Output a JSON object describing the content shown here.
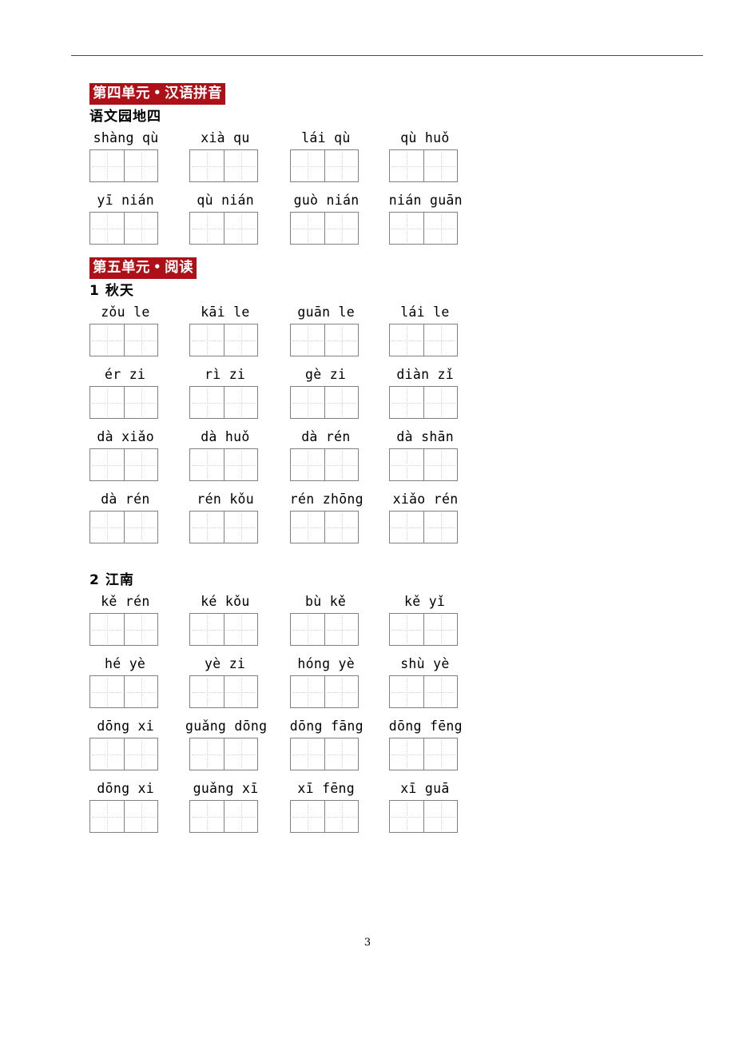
{
  "document": {
    "page_number": "3",
    "accent_color": "#ad1016",
    "grid_border_color": "#808080",
    "guide_color": "#d2d2d2"
  },
  "sections": [
    {
      "banner": {
        "unit": "第四单元",
        "separator": "•",
        "topic": "汉语拼音"
      },
      "lessons": [
        {
          "number": "",
          "title": "语文园地四",
          "blocks": [
            {
              "pinyin": [
                "shàng qù",
                "xià qu",
                "lái qù",
                "qù huǒ"
              ],
              "boxes": 4
            },
            {
              "pinyin": [
                "yī nián",
                "qù nián",
                "guò nián",
                "nián guān"
              ],
              "boxes": 4
            }
          ]
        }
      ]
    },
    {
      "banner": {
        "unit": "第五单元",
        "separator": "•",
        "topic": "阅读"
      },
      "lessons": [
        {
          "number": "1",
          "title": "秋天",
          "blocks": [
            {
              "pinyin": [
                "zǒu le",
                "kāi le",
                "guān le",
                "lái le"
              ],
              "boxes": 4
            },
            {
              "pinyin": [
                "ér zi",
                "rì zi",
                "gè zi",
                "diàn zǐ"
              ],
              "boxes": 4
            },
            {
              "pinyin": [
                "dà xiǎo",
                "dà huǒ",
                "dà rén",
                "dà shān"
              ],
              "boxes": 4
            },
            {
              "pinyin": [
                "dà rén",
                "rén kǒu",
                "rén zhōng",
                "xiǎo rén"
              ],
              "boxes": 4
            }
          ]
        },
        {
          "number": "2",
          "title": "江南",
          "blocks": [
            {
              "pinyin": [
                "kě rén",
                "ké kǒu",
                "bù kě",
                "kě yǐ"
              ],
              "boxes": 4
            },
            {
              "pinyin": [
                "hé yè",
                "yè zi",
                "hóng yè",
                "shù yè"
              ],
              "boxes": 4
            },
            {
              "pinyin": [
                "dōng xi",
                "guǎng dōng",
                "dōng fāng",
                "dōng fēng"
              ],
              "boxes": 4
            },
            {
              "pinyin": [
                "dōng xi",
                "guǎng xī",
                "xī fēng",
                "xī guā"
              ],
              "boxes": 4
            }
          ]
        }
      ]
    }
  ]
}
